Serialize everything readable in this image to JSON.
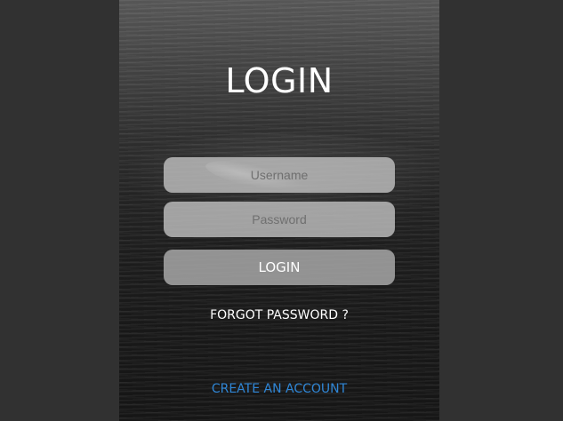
{
  "login_panel": {
    "title": "LOGIN",
    "username": {
      "placeholder": "Username",
      "value": ""
    },
    "password": {
      "placeholder": "Password",
      "value": ""
    },
    "login_button_label": "LOGIN",
    "forgot_password_label": "FORGOT PASSWORD ?",
    "create_account_label": "CREATE AN ACCOUNT"
  },
  "colors": {
    "page_background": "#313131",
    "link_accent": "#2f86d6",
    "text_primary": "#ffffff"
  }
}
